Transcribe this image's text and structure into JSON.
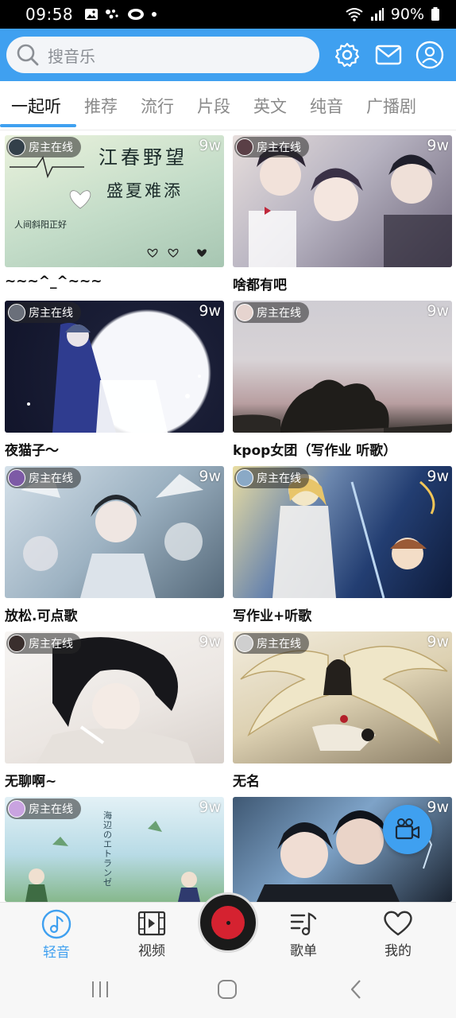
{
  "status_bar": {
    "time": "09:58",
    "battery": "90%"
  },
  "search": {
    "placeholder": "搜音乐"
  },
  "tabs": [
    {
      "label": "一起听",
      "active": true
    },
    {
      "label": "推荐"
    },
    {
      "label": "流行"
    },
    {
      "label": "片段"
    },
    {
      "label": "英文"
    },
    {
      "label": "纯音"
    },
    {
      "label": "广播剧"
    }
  ],
  "owner_badge": "房主在线",
  "rooms": [
    {
      "title": "~~~^_^~~~",
      "count": "9w",
      "thumb_colors": [
        "#e6f0d8",
        "#b9d7c3",
        "#8fb39d"
      ],
      "thumb_text": [
        "江春野望",
        "盛夏难添",
        "人间斜阳正好",
        "♡ + ♡ ="
      ]
    },
    {
      "title": "啥都有吧",
      "count": "9w",
      "thumb_colors": [
        "#d6c9c6",
        "#a09aa8",
        "#5b5266"
      ]
    },
    {
      "title": "夜猫子～",
      "count": "9w",
      "thumb_colors": [
        "#1e2340",
        "#f2f3f7",
        "#2e3b88"
      ]
    },
    {
      "title": "kpop女团（写作业 听歌）",
      "count": "9w",
      "thumb_colors": [
        "#dcd8dc",
        "#b49ea1",
        "#2c2a26"
      ]
    },
    {
      "title": "放松.可点歌",
      "count": "9w",
      "thumb_colors": [
        "#c3d3df",
        "#8aa2b4",
        "#3c4b58"
      ]
    },
    {
      "title": "写作业+听歌",
      "count": "9w",
      "thumb_colors": [
        "#eedfa8",
        "#3b5f8f",
        "#12224a"
      ]
    },
    {
      "title": "无聊啊~",
      "count": "9w",
      "thumb_colors": [
        "#f4f1ee",
        "#d9d3cf",
        "#222"
      ]
    },
    {
      "title": "无名",
      "count": "9w",
      "thumb_colors": [
        "#f1ebd8",
        "#cfc39f",
        "#5b5244"
      ]
    },
    {
      "title": "",
      "count": "9w",
      "thumb_colors": [
        "#d8ecf3",
        "#a9d0db",
        "#5c8f6a"
      ],
      "thumb_text": [
        "海辺のエトランゼ"
      ]
    },
    {
      "title": "",
      "count": "9w",
      "thumb_colors": [
        "#2f4258",
        "#6a8fb6",
        "#11161e"
      ]
    }
  ],
  "bottom_nav": [
    {
      "label": "轻音",
      "icon": "music-note-icon",
      "active": true
    },
    {
      "label": "视频",
      "icon": "film-icon"
    },
    {
      "label": "歌单",
      "icon": "playlist-icon"
    },
    {
      "label": "我的",
      "icon": "heart-icon"
    }
  ],
  "colors": {
    "accent": "#3fa0f0",
    "disc_red": "#d52230"
  }
}
